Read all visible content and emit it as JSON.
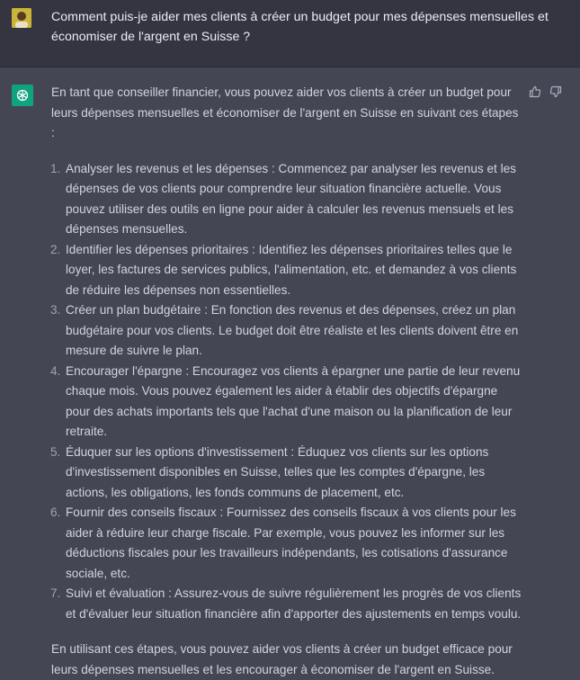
{
  "user": {
    "message": "Comment puis-je aider mes clients à créer un budget pour mes dépenses mensuelles et économiser de l'argent en Suisse ?"
  },
  "assistant": {
    "intro": "En tant que conseiller financier, vous pouvez aider vos clients à créer un budget pour leurs dépenses mensuelles et économiser de l'argent en Suisse en suivant ces étapes :",
    "steps": [
      {
        "num": "1.",
        "text": "Analyser les revenus et les dépenses : Commencez par analyser les revenus et les dépenses de vos clients pour comprendre leur situation financière actuelle. Vous pouvez utiliser des outils en ligne pour aider à calculer les revenus mensuels et les dépenses mensuelles."
      },
      {
        "num": "2.",
        "text": "Identifier les dépenses prioritaires : Identifiez les dépenses prioritaires telles que le loyer, les factures de services publics, l'alimentation, etc. et demandez à vos clients de réduire les dépenses non essentielles."
      },
      {
        "num": "3.",
        "text": "Créer un plan budgétaire : En fonction des revenus et des dépenses, créez un plan budgétaire pour vos clients. Le budget doit être réaliste et les clients doivent être en mesure de suivre le plan."
      },
      {
        "num": "4.",
        "text": "Encourager l'épargne : Encouragez vos clients à épargner une partie de leur revenu chaque mois. Vous pouvez également les aider à établir des objectifs d'épargne pour des achats importants tels que l'achat d'une maison ou la planification de leur retraite."
      },
      {
        "num": "5.",
        "text": "Éduquer sur les options d'investissement : Éduquez vos clients sur les options d'investissement disponibles en Suisse, telles que les comptes d'épargne, les actions, les obligations, les fonds communs de placement, etc."
      },
      {
        "num": "6.",
        "text": "Fournir des conseils fiscaux : Fournissez des conseils fiscaux à vos clients pour les aider à réduire leur charge fiscale. Par exemple, vous pouvez les informer sur les déductions fiscales pour les travailleurs indépendants, les cotisations d'assurance sociale, etc."
      },
      {
        "num": "7.",
        "text": "Suivi et évaluation : Assurez-vous de suivre régulièrement les progrès de vos clients et d'évaluer leur situation financière afin d'apporter des ajustements en temps voulu."
      }
    ],
    "conclusion": "En utilisant ces étapes, vous pouvez aider vos clients à créer un budget efficace pour leurs dépenses mensuelles et les encourager à économiser de l'argent en Suisse."
  },
  "icons": {
    "user_avatar": "user-avatar-icon",
    "assistant_logo": "openai-logo-icon",
    "thumbs_up": "thumbs-up-icon",
    "thumbs_down": "thumbs-down-icon"
  },
  "colors": {
    "user_bg": "#343541",
    "assistant_bg": "#444654",
    "logo_bg": "#10a37f",
    "avatar_bg": "#c9b53a"
  }
}
